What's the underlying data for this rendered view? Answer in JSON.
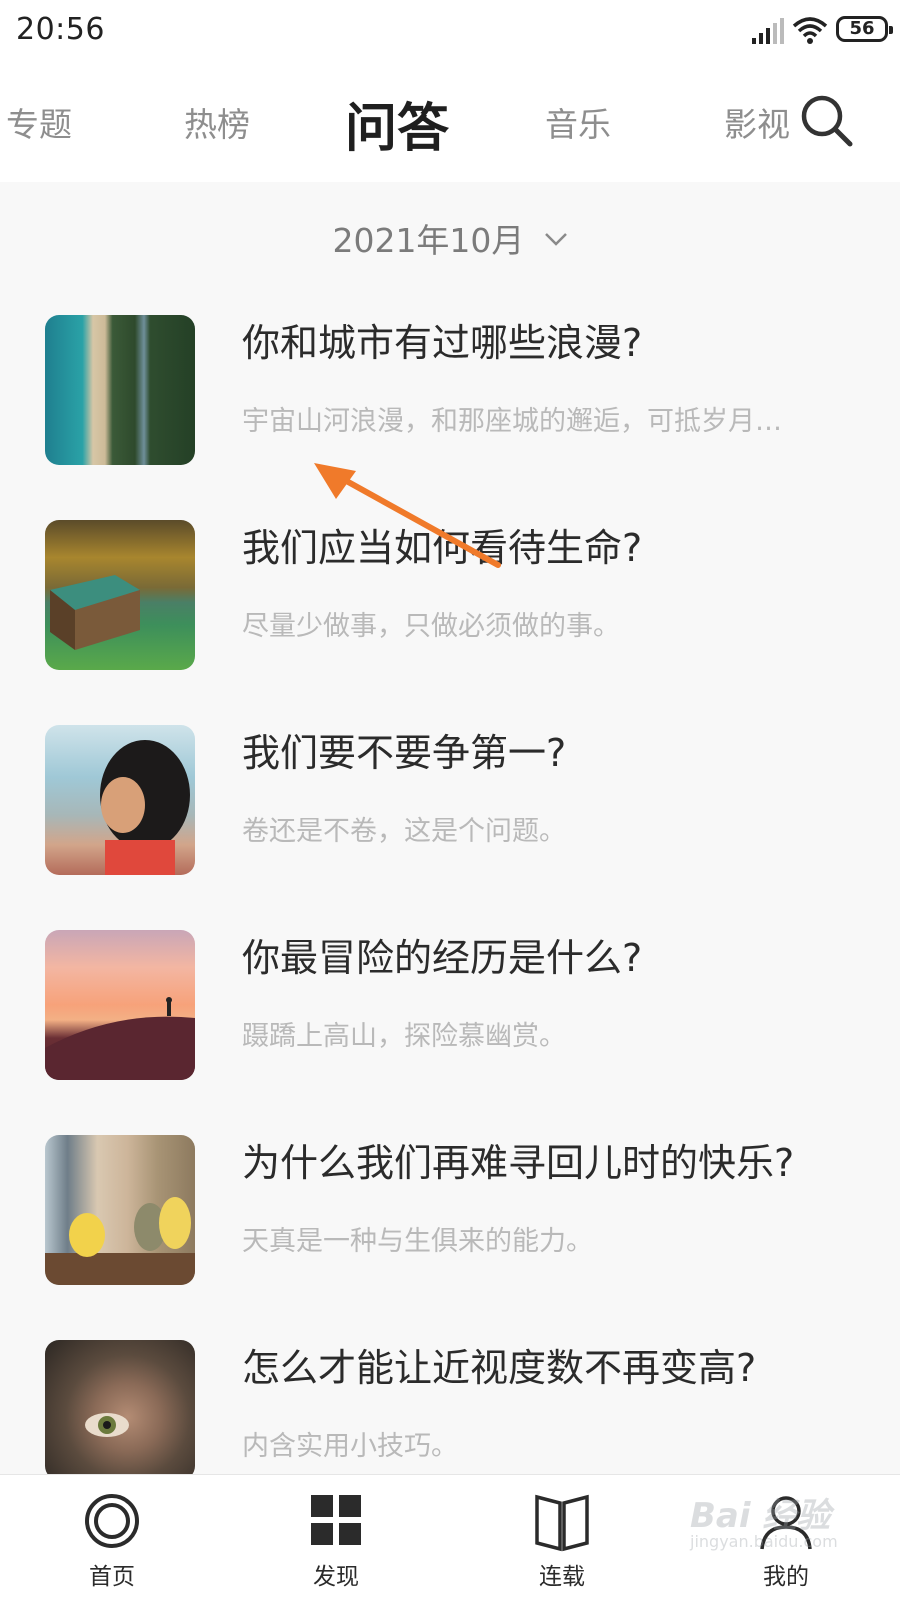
{
  "status_bar": {
    "time": "20:56",
    "battery": "56"
  },
  "top_nav": {
    "tabs": [
      {
        "label": "专题"
      },
      {
        "label": "热榜"
      },
      {
        "label": "问答"
      },
      {
        "label": "音乐"
      },
      {
        "label": "影视"
      }
    ],
    "active_tab": "问答"
  },
  "date_selector": {
    "label": "2021年10月"
  },
  "questions": [
    {
      "title": "你和城市有过哪些浪漫?",
      "subtitle": "宇宙山河浪漫，和那座城的邂逅，可抵岁月…"
    },
    {
      "title": "我们应当如何看待生命?",
      "subtitle": "尽量少做事，只做必须做的事。"
    },
    {
      "title": "我们要不要争第一?",
      "subtitle": "卷还是不卷，这是个问题。"
    },
    {
      "title": "你最冒险的经历是什么?",
      "subtitle": "蹑蹻上高山，探险慕幽赏。"
    },
    {
      "title": "为什么我们再难寻回儿时的快乐?",
      "subtitle": "天真是一种与生俱来的能力。"
    },
    {
      "title": "怎么才能让近视度数不再变高?",
      "subtitle": "内含实用小技巧。"
    }
  ],
  "bottom_nav": {
    "items": [
      {
        "label": "首页",
        "icon": "home-ring-icon"
      },
      {
        "label": "发现",
        "icon": "grid-icon"
      },
      {
        "label": "连载",
        "icon": "book-icon"
      },
      {
        "label": "我的",
        "icon": "user-icon"
      }
    ]
  },
  "watermark": {
    "brand": "Bai 经验",
    "url": "jingyan.baidu.com"
  },
  "colors": {
    "annotation_arrow": "#f07a2a",
    "title_text": "#2b2b2b",
    "subtitle_text": "#b9b9b9",
    "inactive_tab": "#8e8e8e"
  }
}
